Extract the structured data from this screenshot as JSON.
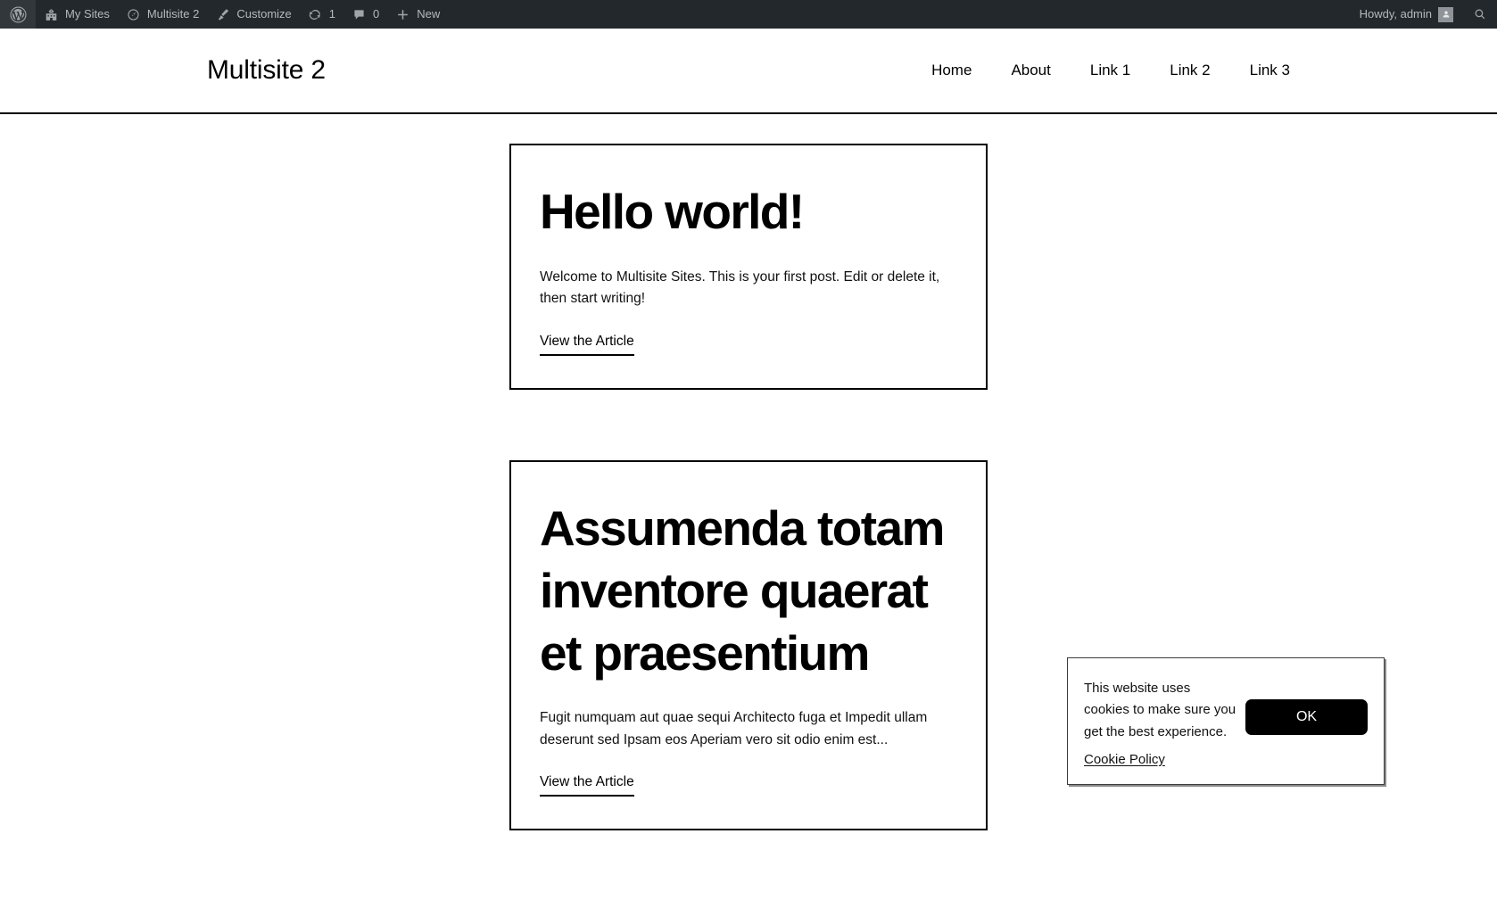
{
  "admin_bar": {
    "left_items": [
      {
        "id": "wp-logo",
        "icon": "wordpress-icon",
        "label": ""
      },
      {
        "id": "my-sites",
        "icon": "buildings-icon",
        "label": "My Sites"
      },
      {
        "id": "site-name",
        "icon": "dashboard-icon",
        "label": "Multisite 2"
      },
      {
        "id": "customize",
        "icon": "paintbrush-icon",
        "label": "Customize"
      },
      {
        "id": "updates",
        "icon": "update-icon",
        "label": "1"
      },
      {
        "id": "comments",
        "icon": "comment-bubble-icon",
        "label": "0"
      },
      {
        "id": "new-content",
        "icon": "plus-icon",
        "label": "New"
      }
    ],
    "howdy": "Howdy, admin",
    "avatar_icon": "user-avatar-icon",
    "search_icon": "search-icon"
  },
  "header": {
    "site_title": "Multisite 2",
    "nav": [
      {
        "label": "Home"
      },
      {
        "label": "About"
      },
      {
        "label": "Link 1"
      },
      {
        "label": "Link 2"
      },
      {
        "label": "Link 3"
      }
    ]
  },
  "posts": [
    {
      "title": "Hello world!",
      "excerpt": "Welcome to Multisite Sites. This is your first post. Edit or delete it, then start writing!",
      "read_more": "View the Article"
    },
    {
      "title": "Assumenda totam inventore quaerat et praesentium",
      "excerpt": "Fugit numquam aut quae sequi Architecto fuga et Impedit ullam deserunt sed Ipsam eos Aperiam vero sit odio enim est...",
      "read_more": "View the Article"
    }
  ],
  "cookie_banner": {
    "message": "This website uses cookies to make sure you get the best experience.",
    "policy_link": "Cookie Policy",
    "ok_label": "OK"
  },
  "colors": {
    "admin_bar_bg": "#23282d",
    "admin_bar_text": "#b4b9be",
    "border": "#000000",
    "button_bg": "#000000",
    "button_text": "#ffffff"
  }
}
